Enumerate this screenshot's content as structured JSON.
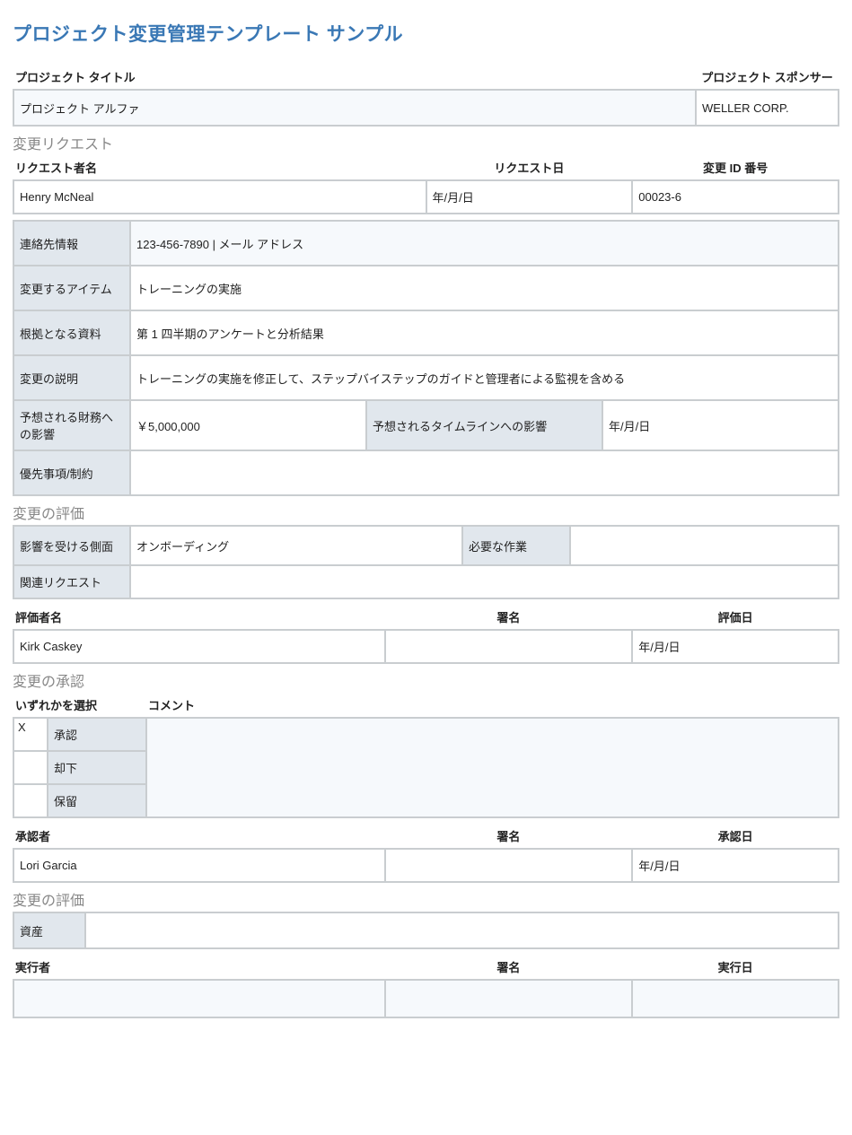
{
  "title": "プロジェクト変更管理テンプレート サンプル",
  "project": {
    "title_label": "プロジェクト タイトル",
    "title_value": "プロジェクト アルファ",
    "sponsor_label": "プロジェクト スポンサー",
    "sponsor_value": "WELLER CORP."
  },
  "request": {
    "section": "変更リクエスト",
    "requester_label": "リクエスト者名",
    "requester_value": "Henry McNeal",
    "date_label": "リクエスト日",
    "date_value": "年/月/日",
    "id_label": "変更 ID 番号",
    "id_value": "00023-6",
    "contact_label": "連絡先情報",
    "contact_value": "123-456-7890 | メール アドレス",
    "item_label": "変更するアイテム",
    "item_value": "トレーニングの実施",
    "basis_label": "根拠となる資料",
    "basis_value": "第 1 四半期のアンケートと分析結果",
    "desc_label": "変更の説明",
    "desc_value": "トレーニングの実施を修正して、ステップバイステップのガイドと管理者による監視を含める",
    "fin_label": "予想される財務への影響",
    "fin_value": "￥5,000,000",
    "timeline_label": "予想されるタイムラインへの影響",
    "timeline_value": "年/月/日",
    "priority_label": "優先事項/制約",
    "priority_value": ""
  },
  "eval": {
    "section": "変更の評価",
    "aspect_label": "影響を受ける側面",
    "aspect_value": "オンボーディング",
    "work_label": "必要な作業",
    "work_value": "",
    "related_label": "関連リクエスト",
    "related_value": "",
    "evaluator_label": "評価者名",
    "evaluator_value": "Kirk Caskey",
    "sig_label": "署名",
    "sig_value": "",
    "date_label": "評価日",
    "date_value": "年/月/日"
  },
  "approval": {
    "section": "変更の承認",
    "choose_label": "いずれかを選択",
    "comment_label": "コメント",
    "comment_value": "",
    "opts": {
      "approve_mark": "X",
      "approve": "承認",
      "reject_mark": "",
      "reject": "却下",
      "defer_mark": "",
      "defer": "保留"
    },
    "approver_label": "承認者",
    "approver_value": "Lori Garcia",
    "sig_label": "署名",
    "sig_value": "",
    "date_label": "承認日",
    "date_value": "年/月/日"
  },
  "impl": {
    "section": "変更の評価",
    "asset_label": "資産",
    "asset_value": "",
    "executor_label": "実行者",
    "executor_value": "",
    "sig_label": "署名",
    "sig_value": "",
    "date_label": "実行日",
    "date_value": ""
  }
}
